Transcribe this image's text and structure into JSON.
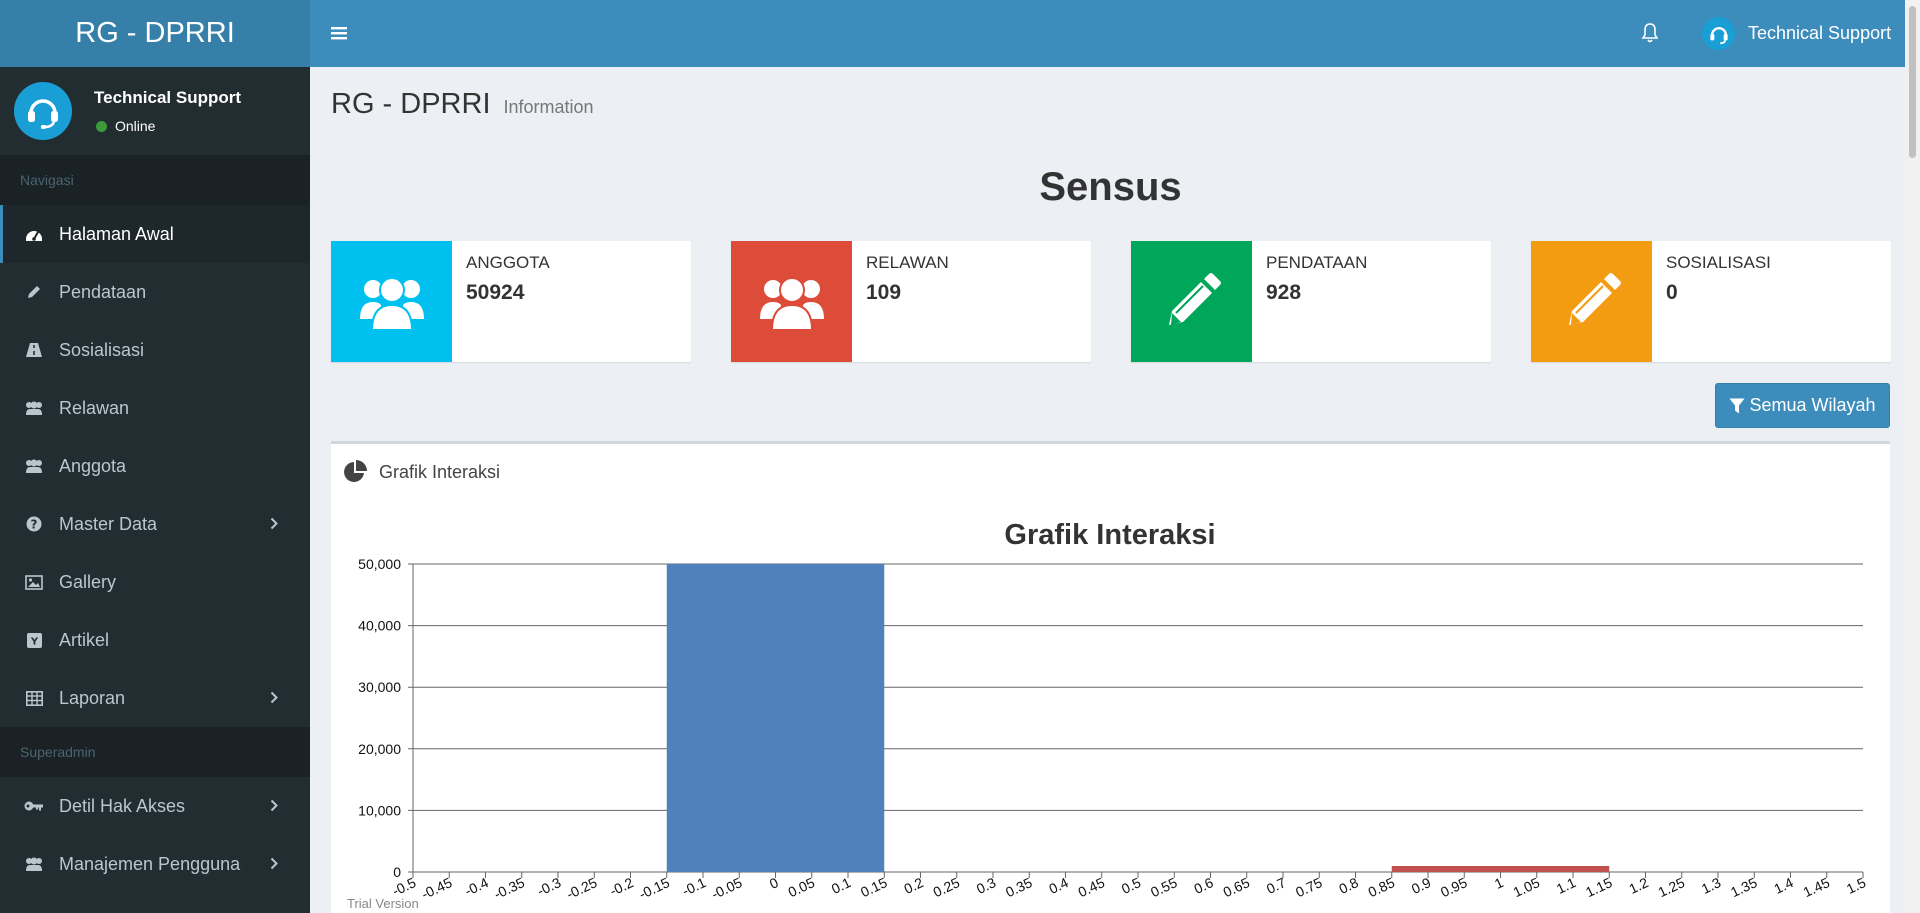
{
  "app": {
    "title": "RG - DPRRI"
  },
  "sidebar": {
    "user_name": "Technical Support",
    "user_status": "Online",
    "header_nav": "Navigasi",
    "header_superadmin": "Superadmin",
    "nav": [
      {
        "label": "Halaman Awal",
        "icon": "dashboard-icon"
      },
      {
        "label": "Pendataan",
        "icon": "pencil-icon"
      },
      {
        "label": "Sosialisasi",
        "icon": "road-icon"
      },
      {
        "label": "Relawan",
        "icon": "users-icon"
      },
      {
        "label": "Anggota",
        "icon": "users-icon"
      },
      {
        "label": "Master Data",
        "icon": "question-circle-icon"
      },
      {
        "label": "Gallery",
        "icon": "image-icon"
      },
      {
        "label": "Artikel",
        "icon": "y-square-icon"
      },
      {
        "label": "Laporan",
        "icon": "table-icon"
      }
    ],
    "admin_nav": [
      {
        "label": "Detil Hak Akses",
        "icon": "key-icon"
      },
      {
        "label": "Manajemen Pengguna",
        "icon": "users-icon"
      }
    ]
  },
  "topbar": {
    "user_name": "Technical Support"
  },
  "page": {
    "title": "RG - DPRRI",
    "subtitle": "Information",
    "heading": "Sensus"
  },
  "stats": [
    {
      "label": "ANGGOTA",
      "value": "50924",
      "color": "#00c0ef",
      "icon": "users-icon"
    },
    {
      "label": "RELAWAN",
      "value": "109",
      "color": "#dd4b39",
      "icon": "users-icon"
    },
    {
      "label": "PENDATAAN",
      "value": "928",
      "color": "#00a65a",
      "icon": "pencil-icon"
    },
    {
      "label": "SOSIALISASI",
      "value": "0",
      "color": "#f39c12",
      "icon": "pencil-icon"
    }
  ],
  "filter_button": {
    "label": "Semua Wilayah"
  },
  "chart_box": {
    "title": "Grafik Interaksi"
  },
  "trial_text": "Trial Version",
  "chart_data": {
    "type": "bar",
    "title": "Grafik Interaksi",
    "xlabel": "",
    "ylabel": "",
    "xlim": [
      -0.5,
      1.5
    ],
    "ylim": [
      0,
      50000
    ],
    "x_ticks": [
      "-0.5",
      "-0.45",
      "-0.4",
      "-0.35",
      "-0.3",
      "-0.25",
      "-0.2",
      "-0.15",
      "-0.1",
      "-0.05",
      "0",
      "0.05",
      "0.1",
      "0.15",
      "0.2",
      "0.25",
      "0.3",
      "0.35",
      "0.4",
      "0.45",
      "0.5",
      "0.55",
      "0.6",
      "0.65",
      "0.7",
      "0.75",
      "0.8",
      "0.85",
      "0.9",
      "0.95",
      "1",
      "1.05",
      "1.1",
      "1.15",
      "1.2",
      "1.25",
      "1.3",
      "1.35",
      "1.4",
      "1.45",
      "1.5"
    ],
    "y_ticks": [
      "0",
      "10,000",
      "20,000",
      "30,000",
      "40,000",
      "50,000"
    ],
    "grid": true,
    "bars": [
      {
        "x_start": -0.15,
        "x_end": 0.15,
        "value": 50924,
        "color": "#4f81bd"
      },
      {
        "x_start": 0.85,
        "x_end": 1.15,
        "value": 928,
        "color": "#c0504d"
      }
    ]
  }
}
